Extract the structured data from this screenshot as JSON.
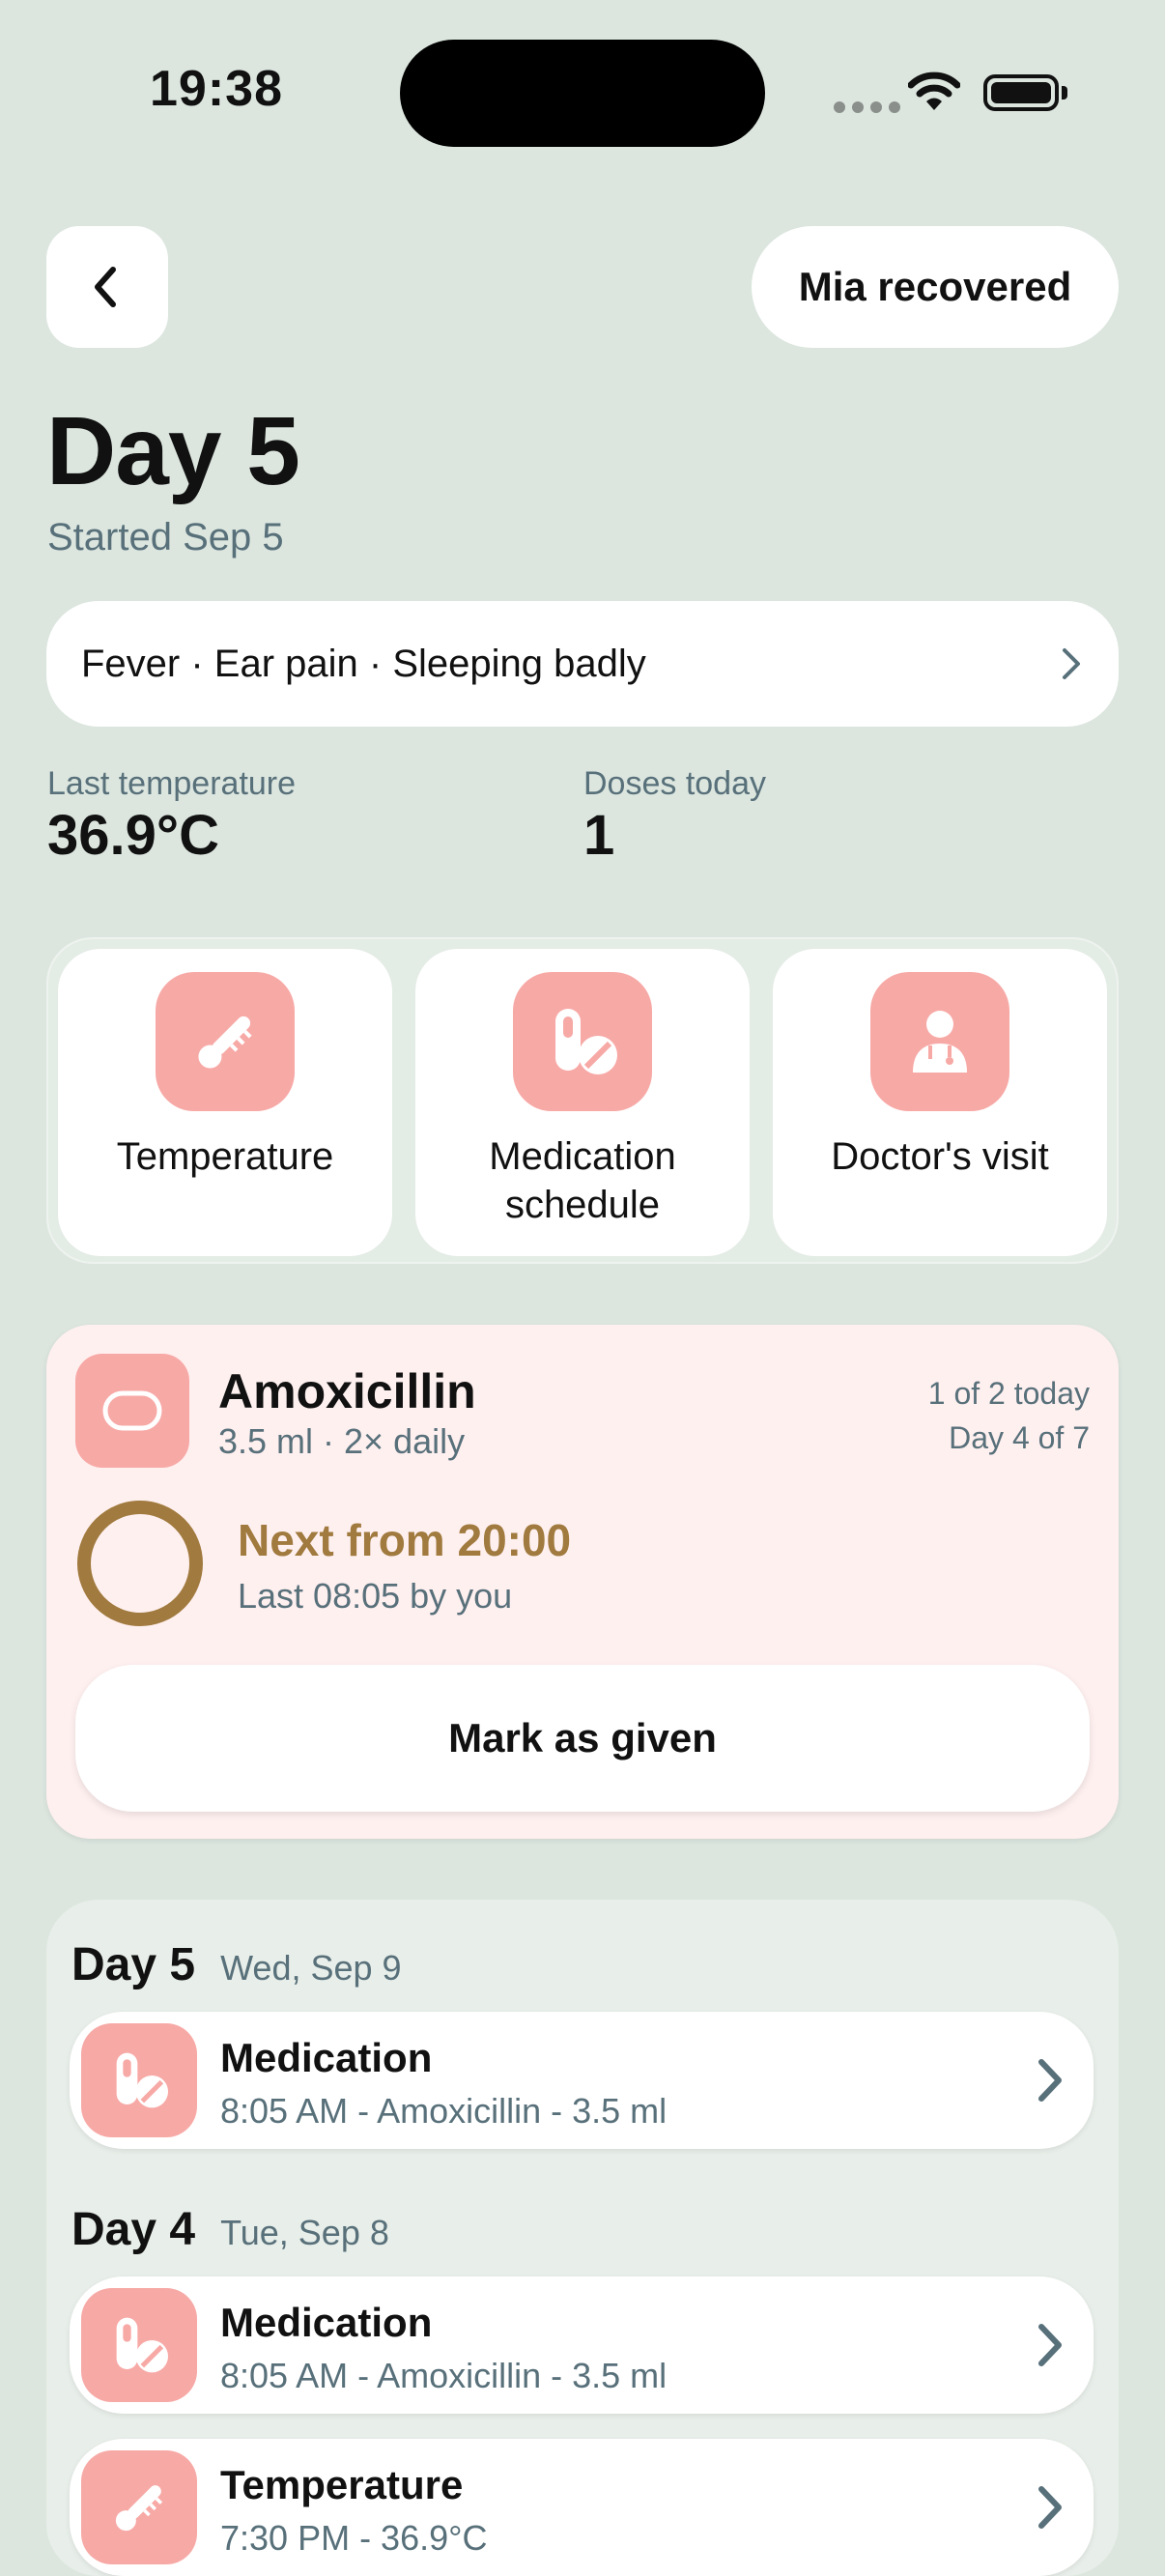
{
  "status_bar": {
    "time": "19:38"
  },
  "header": {
    "back_icon": "chevron-left-icon",
    "recovered_label": "Mia recovered"
  },
  "overview": {
    "title": "Day 5",
    "started": "Started Sep 5",
    "symptoms": "Fever · Ear pain · Sleeping badly",
    "last_temp_label": "Last temperature",
    "last_temp_value": "36.9°C",
    "doses_label": "Doses today",
    "doses_value": "1"
  },
  "actions": [
    {
      "label": "Temperature",
      "icon": "thermometer-icon"
    },
    {
      "label": "Medication schedule",
      "icon": "pills-icon"
    },
    {
      "label": "Doctor's visit",
      "icon": "doctor-icon"
    }
  ],
  "medication_card": {
    "name": "Amoxicillin",
    "dose": "3.5 ml · 2× daily",
    "progress_today": "1 of 2 today",
    "course_day": "Day 4 of 7",
    "next": "Next from 20:00",
    "last": "Last 08:05 by you",
    "mark_button": "Mark as given"
  },
  "history": [
    {
      "day": "Day 5",
      "date": "Wed, Sep 9",
      "entries": [
        {
          "title": "Medication",
          "subtitle": "8:05 AM - Amoxicillin - 3.5 ml"
        }
      ]
    },
    {
      "day": "Day 4",
      "date": "Tue, Sep 8",
      "entries": [
        {
          "title": "Medication",
          "subtitle": "8:05 AM - Amoxicillin - 3.5 ml"
        },
        {
          "title": "Temperature",
          "subtitle": "7:30 PM - 36.9°C"
        }
      ]
    }
  ],
  "colors": {
    "background": "#dce6df",
    "accent_pink": "#f7a9a6",
    "card_pink": "#fff0f0",
    "next_gold": "#a07a3e",
    "muted_text": "#58707a"
  }
}
